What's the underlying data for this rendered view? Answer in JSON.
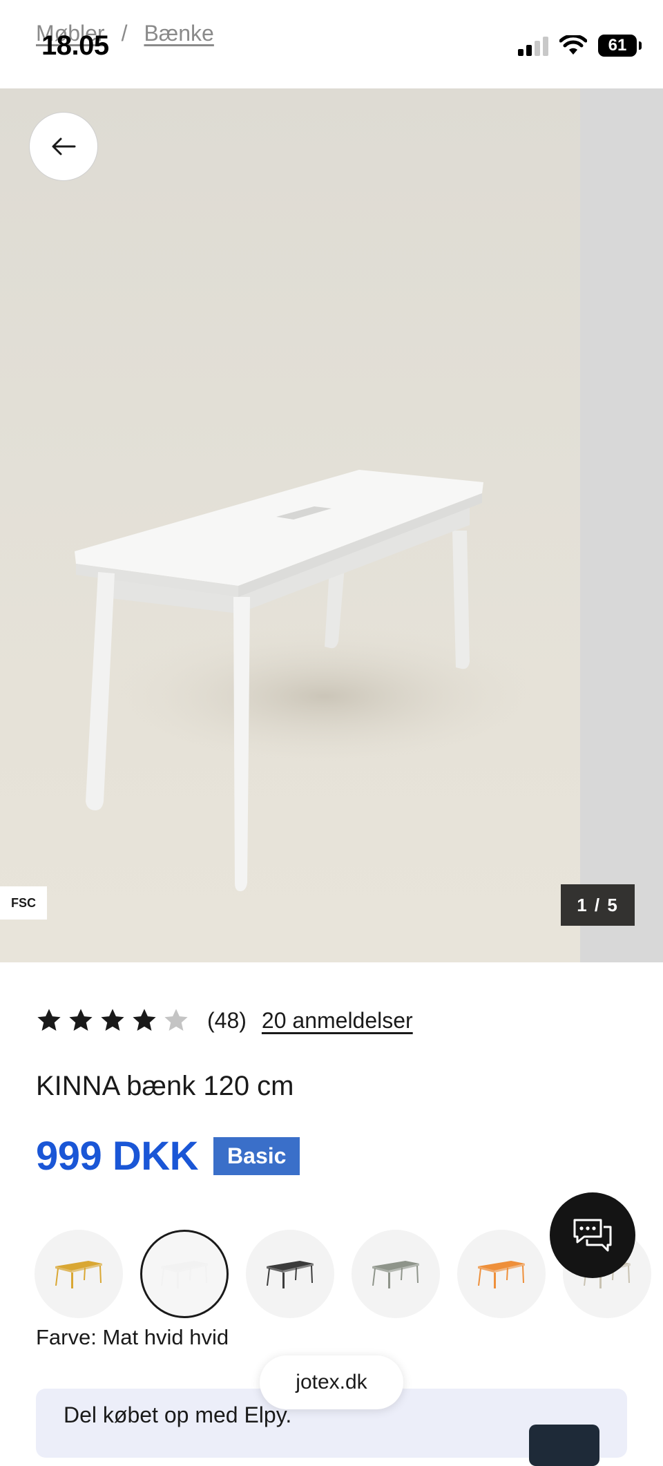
{
  "status_bar": {
    "time": "18.05",
    "battery": "61"
  },
  "breadcrumb": {
    "items": [
      "Møbler",
      "Bænke"
    ],
    "separator": "/"
  },
  "gallery": {
    "fsc_label": "FSC",
    "counter": "1 / 5",
    "current": 1,
    "total": 5
  },
  "product": {
    "rating": 4,
    "rating_max": 5,
    "rating_count": "(48)",
    "reviews_link": "20 anmeldelser",
    "title": "KINNA bænk 120 cm",
    "price": "999 DKK",
    "badge": "Basic"
  },
  "swatches": {
    "colors": [
      "#d9a733",
      "#f2f2f2",
      "#3b3b3b",
      "#8e948a",
      "#ee8f3a",
      "#c8c2b2"
    ],
    "selected_index": 1,
    "label": "Farve: Mat hvid hvid"
  },
  "browser": {
    "url": "jotex.dk"
  },
  "elpy": {
    "text": "Del købet op med Elpy."
  },
  "colors": {
    "price": "#1a56d6",
    "badge": "#3a6fc9",
    "chat_button": "#141414"
  },
  "icons": {
    "back": "arrow-left-icon",
    "chat": "chat-bubbles-icon"
  }
}
